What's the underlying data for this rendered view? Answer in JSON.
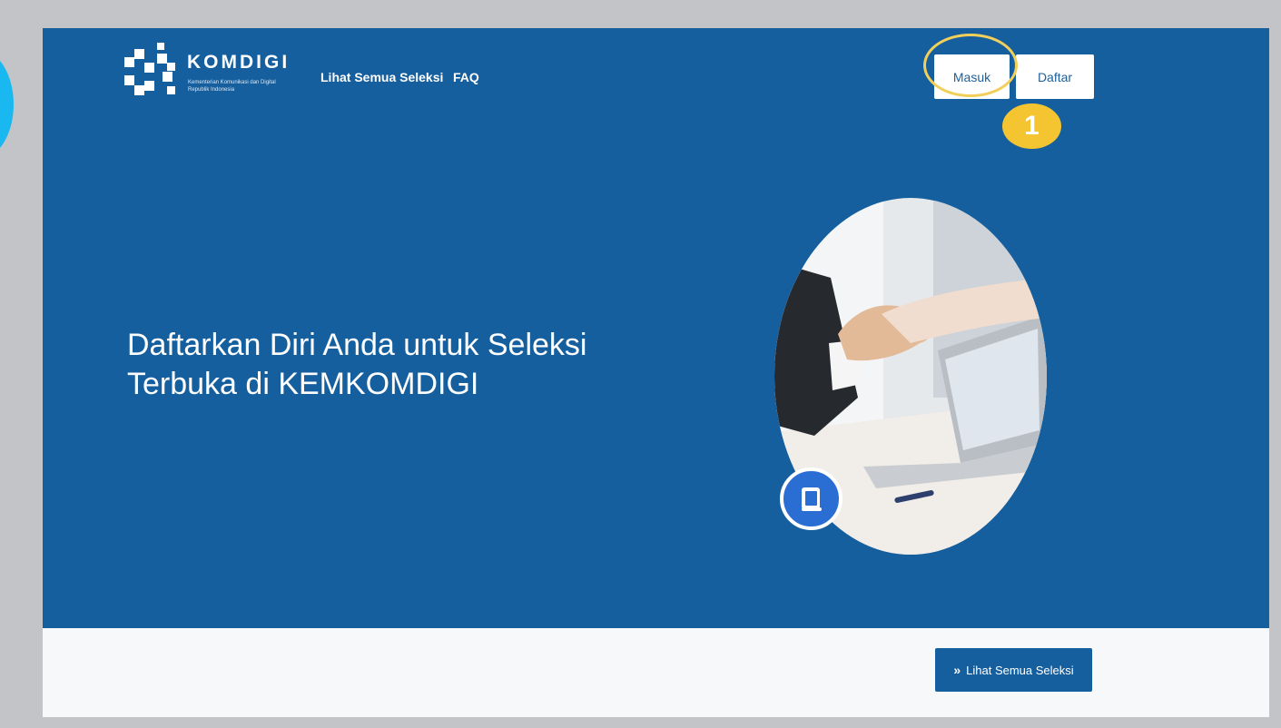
{
  "header": {
    "logo": {
      "wordmark": "KOMDIGI",
      "subtitle_line1": "Kementerian Komunikasi dan Digital",
      "subtitle_line2": "Republik Indonesia"
    },
    "nav": [
      {
        "label": "Lihat Semua Seleksi"
      },
      {
        "label": "FAQ"
      }
    ],
    "login_label": "Masuk",
    "register_label": "Daftar"
  },
  "annotation": {
    "step_number": "1",
    "highlight_color": "#f2cf5a"
  },
  "hero": {
    "title_line1": "Daftarkan Diri Anda untuk Seleksi",
    "title_line2": "Terbuka di KEMKOMDIGI",
    "background_color": "#165f9e",
    "image_icon": "handshake-photo",
    "badge_icon": "book-icon"
  },
  "lower_section": {
    "button_chevron": "»",
    "button_label": "Lihat Semua Seleksi"
  }
}
